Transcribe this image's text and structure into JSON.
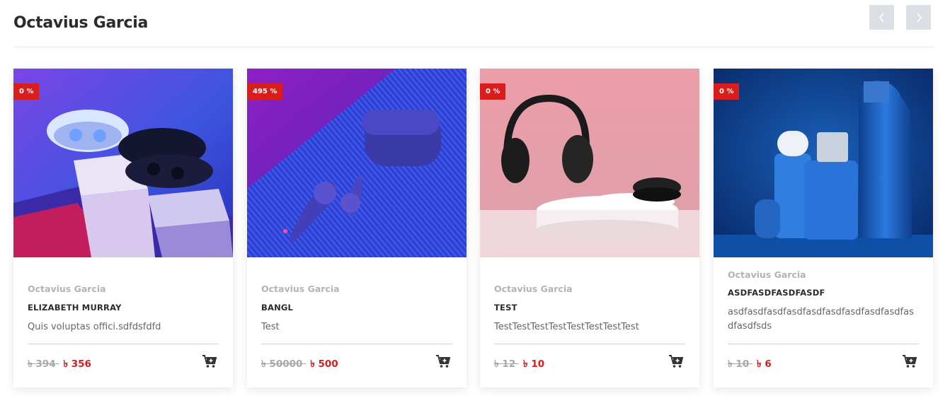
{
  "header": {
    "title": "Octavius Garcia"
  },
  "icons": {
    "prev": "chevron-left-icon",
    "next": "chevron-right-icon",
    "cart": "add-to-cart-icon"
  },
  "colors": {
    "accent": "#d91c1c",
    "nav_button": "#dcdfe3"
  },
  "products": [
    {
      "badge": "0 %",
      "brand": "Octavius Garcia",
      "name": "ELIZABETH MURRAY",
      "description": "Quis voluptas offici.sdfdsfdfd",
      "old_price": "৳ 394",
      "new_price": "৳ 356"
    },
    {
      "badge": "495 %",
      "brand": "Octavius Garcia",
      "name": "BANGL",
      "description": "Test",
      "old_price": "৳ 50000",
      "new_price": "৳ 500"
    },
    {
      "badge": "0 %",
      "brand": "Octavius Garcia",
      "name": "TEST",
      "description": "TestTestTestTestTestTestTestTest",
      "old_price": "৳ 12",
      "new_price": "৳ 10"
    },
    {
      "badge": "0 %",
      "brand": "Octavius Garcia",
      "name": "ASDFASDFASDFASDF",
      "description": "asdfasdfasdfasdfasdfasdfasdfasdfasdfasdfasdfsds",
      "old_price": "৳ 10",
      "new_price": "৳ 6"
    }
  ]
}
